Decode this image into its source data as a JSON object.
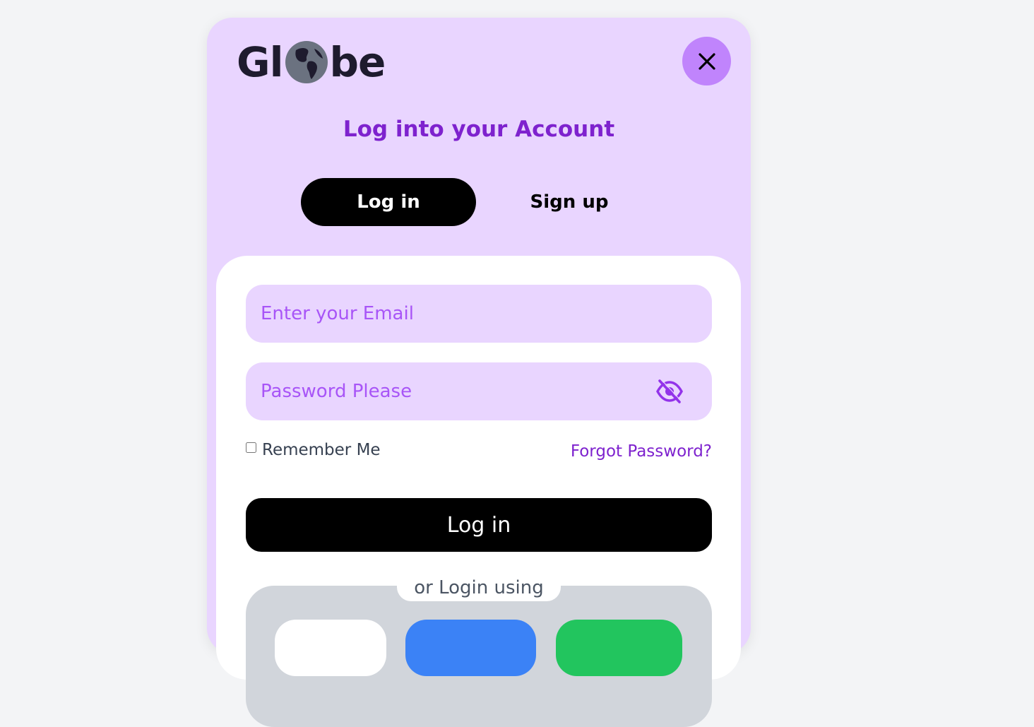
{
  "brand": {
    "logo_before": "Gl",
    "logo_after": "be",
    "icon": "globe-icon"
  },
  "header": {
    "title": "Log into your Account",
    "close_icon": "close-icon"
  },
  "tabs": [
    {
      "label": "Log in",
      "active": true
    },
    {
      "label": "Sign up",
      "active": false
    }
  ],
  "form": {
    "email_placeholder": "Enter your Email",
    "password_placeholder": "Password Please",
    "password_toggle_icon": "eye-off-icon",
    "remember_label": "Remember Me",
    "remember_checked": false,
    "forgot_label": "Forgot Password?",
    "submit_label": "Log in"
  },
  "social": {
    "divider_label": "or Login using",
    "buttons": [
      {
        "color": "#ffffff"
      },
      {
        "color": "#3b82f6"
      },
      {
        "color": "#22c55e"
      }
    ]
  },
  "colors": {
    "accent": "#7e22ce",
    "card_bg": "#e9d5ff",
    "close_bg": "#c084fc",
    "page_bg": "#f3f4f6"
  }
}
